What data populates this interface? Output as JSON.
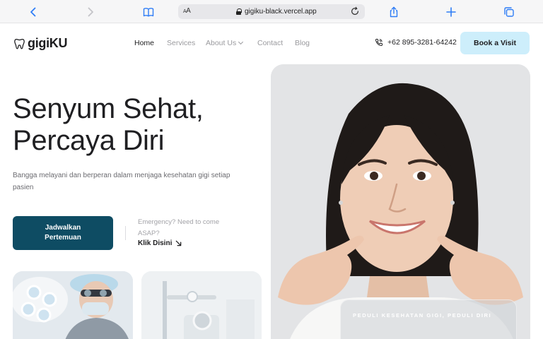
{
  "browser": {
    "url": "gigiku-black.vercel.app",
    "aa_label_small": "A",
    "aa_label_large": "A"
  },
  "nav": {
    "logo_text": "gigiKU",
    "links": [
      "Home",
      "Services",
      "About Us",
      "Contact",
      "Blog"
    ],
    "active_link": "Home",
    "phone": "+62 895-3281-64242",
    "book_button": "Book a Visit"
  },
  "hero": {
    "title_line1": "Senyum Sehat,",
    "title_line2": "Percaya Diri",
    "subtitle": "Bangga melayani dan berperan dalam menjaga kesehatan gigi setiap pasien",
    "cta_line1": "Jadwalkan",
    "cta_line2": "Pertemuan",
    "emergency_text": "Emergency? Need to come ASAP?",
    "emergency_link": "Klik Disini"
  },
  "photo": {
    "caption": "PEDULI KESEHATAN GIGI, PEDULI DIRI"
  },
  "colors": {
    "accent_dark": "#0e4c63",
    "accent_light": "#cdeefb",
    "browser_blue": "#2f7df6"
  },
  "icons": [
    "back-icon",
    "forward-icon",
    "bookmarks-icon",
    "lock-icon",
    "reload-icon",
    "share-icon",
    "new-tab-icon",
    "tabs-icon",
    "tooth-icon",
    "phone-icon",
    "arrow-down-right-icon",
    "chevron-down-icon"
  ]
}
